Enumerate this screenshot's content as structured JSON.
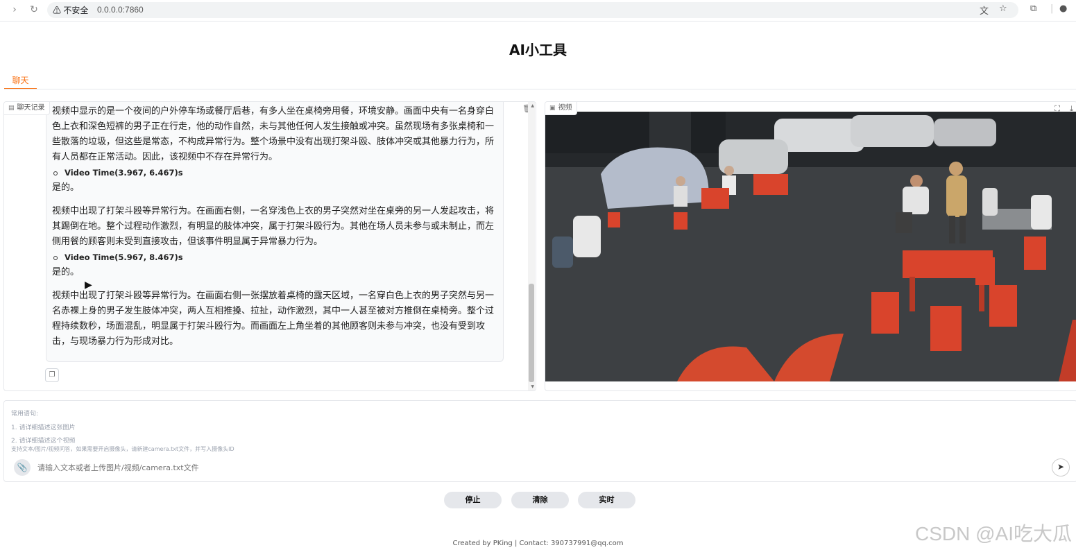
{
  "browser": {
    "security_label": "⚠ 不安全",
    "url": "0.0.0.0:7860"
  },
  "app": {
    "title": "AI小工具"
  },
  "tabs": [
    {
      "label": "聊天",
      "active": true
    }
  ],
  "chat_panel": {
    "label": "聊天记录",
    "paragraphs": [
      "视频中显示的是一个夜间的户外停车场或餐厅后巷，有多人坐在桌椅旁用餐，环境安静。画面中央有一名身穿白色上衣和深色短裤的男子正在行走，他的动作自然，未与其他任何人发生接触或冲突。虽然现场有多张桌椅和一些散落的垃圾，但这些是常态，不构成异常行为。整个场景中没有出现打架斗殴、肢体冲突或其他暴力行为，所有人员都在正常活动。因此，该视频中不存在异常行为。",
      "视频中出现了打架斗殴等异常行为。在画面右侧，一名穿浅色上衣的男子突然对坐在桌旁的另一人发起攻击，将其踢倒在地。整个过程动作激烈，有明显的肢体冲突，属于打架斗殴行为。其他在场人员未参与或未制止，而左侧用餐的顾客则未受到直接攻击，但该事件明显属于异常暴力行为。",
      "视频中出现了打架斗殴等异常行为。在画面右侧一张摆放着桌椅的露天区域，一名穿白色上衣的男子突然与另一名赤裸上身的男子发生肢体冲突，两人互相推搡、拉扯，动作激烈，其中一人甚至被对方推倒在桌椅旁。整个过程持续数秒，场面混乱，明显属于打架斗殴行为。而画面左上角坐着的其他顾客则未参与冲突，也没有受到攻击，与现场暴力行为形成对比。"
    ],
    "time_1": "Video Time(3.967, 6.467)s",
    "answer_1": "是的。",
    "time_2": "Video Time(5.967, 8.467)s",
    "answer_2": "是的。"
  },
  "video_panel": {
    "label": "视频"
  },
  "input": {
    "hint_title": "常用语句:",
    "hint_1": "1. 请详细描述这张图片",
    "hint_2": "2. 请详细描述这个视频",
    "hint_3": "支持文本/图片/视频问答，如果需要开启摄像头，请新建camera.txt文件，并写入摄像头ID",
    "placeholder": "请输入文本或者上传图片/视频/camera.txt文件"
  },
  "buttons": {
    "stop": "停止",
    "clear": "清除",
    "realtime": "实时"
  },
  "footer": "Created by PKing | Contact: 390737991@qq.com",
  "watermark": "CSDN @AI吃大瓜",
  "colors": {
    "accent": "#f97316",
    "chair_red": "#d9442c"
  }
}
